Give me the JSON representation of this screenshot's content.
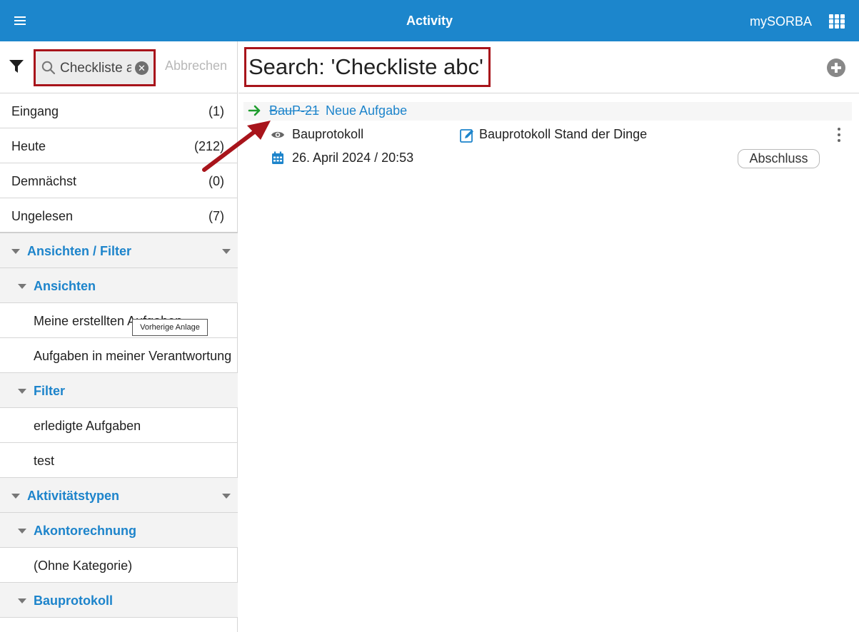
{
  "header": {
    "title": "Activity",
    "app_name": "mySORBA",
    "icons": {
      "menu": "hamburger-icon",
      "apps": "apps-grid-icon"
    },
    "color": "#1c86cc"
  },
  "search": {
    "value": "Checkliste abc",
    "cancel_label": "Abbrechen",
    "icons": {
      "filter": "filter-icon",
      "search": "search-icon",
      "clear": "clear-icon"
    }
  },
  "nav": {
    "inbox": {
      "label": "Eingang",
      "count": "(1)"
    },
    "today": {
      "label": "Heute",
      "count": "(212)"
    },
    "soon": {
      "label": "Demnächst",
      "count": "(0)"
    },
    "unread": {
      "label": "Ungelesen",
      "count": "(7)"
    },
    "views_filters": "Ansichten / Filter",
    "views": "Ansichten",
    "view_items": [
      "Meine erstellten Aufgaben",
      "Aufgaben in meiner Verantwortung"
    ],
    "filter": "Filter",
    "filter_items": [
      "erledigte Aufgaben",
      "test"
    ],
    "activity_types": "Aktivitätstypen",
    "akonto": "Akontorechnung",
    "akonto_items": [
      "(Ohne Kategorie)"
    ],
    "bauprotokoll": "Bauprotokoll"
  },
  "tooltip": "Vorherige Anlage",
  "main": {
    "search_title": "Search: 'Checkliste abc'",
    "activity": {
      "id": "BauP-21",
      "name": "Neue Aufgabe",
      "type": "Bauprotokoll",
      "description": "Bauprotokoll Stand der Dinge",
      "date": "26. April 2024 / 20:53",
      "action_label": "Abschluss"
    }
  },
  "colors": {
    "accent": "#1d84cb",
    "highlight": "#a8141b",
    "arrow_green": "#1f9d2e"
  }
}
